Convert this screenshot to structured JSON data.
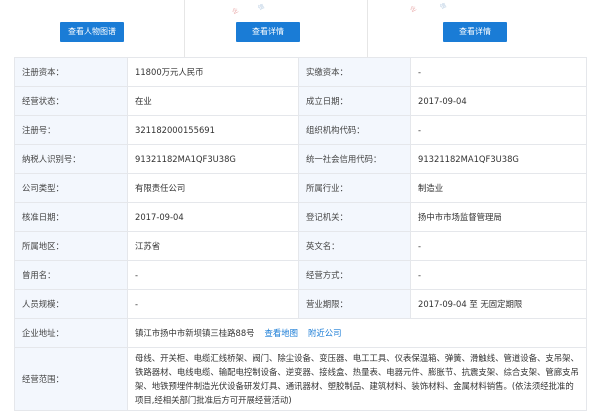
{
  "buttons": {
    "view_person_graph": "查看人物图谱",
    "view_detail_1": "查看详情",
    "view_detail_2": "查看详情"
  },
  "fields": {
    "reg_capital_label": "注册资本：",
    "reg_capital_value": "11800万元人民币",
    "paid_capital_label": "实缴资本：",
    "paid_capital_value": "-",
    "status_label": "经营状态：",
    "status_value": "在业",
    "est_date_label": "成立日期：",
    "est_date_value": "2017-09-04",
    "reg_no_label": "注册号：",
    "reg_no_value": "321182000155691",
    "org_code_label": "组织机构代码：",
    "org_code_value": "-",
    "taxpayer_id_label": "纳税人识别号：",
    "taxpayer_id_value": "91321182MA1QF3U38G",
    "credit_code_label": "统一社会信用代码：",
    "credit_code_value": "91321182MA1QF3U38G",
    "company_type_label": "公司类型：",
    "company_type_value": "有限责任公司",
    "industry_label": "所属行业：",
    "industry_value": "制造业",
    "approve_date_label": "核准日期：",
    "approve_date_value": "2017-09-04",
    "reg_authority_label": "登记机关：",
    "reg_authority_value": "扬中市市场监督管理局",
    "region_label": "所属地区：",
    "region_value": "江苏省",
    "english_name_label": "英文名：",
    "english_name_value": "-",
    "former_name_label": "曾用名：",
    "former_name_value": "-",
    "biz_mode_label": "经营方式：",
    "biz_mode_value": "-",
    "staff_size_label": "人员规模：",
    "staff_size_value": "-",
    "biz_term_label": "营业期限：",
    "biz_term_value": "2017-09-04 至 无固定期限",
    "address_label": "企业地址：",
    "address_value": "镇江市扬中市新坝镇三桂路88号",
    "address_map_link": "查看地图",
    "address_nearby_link": "附近公司",
    "scope_label": "经营范围：",
    "scope_value": "母线、开关柜、电缆汇线桥架、阀门、除尘设备、变压器、电工工具、仪表保温箱、弹簧、滑触线、管道设备、支吊架、铁路器材、电线电缆、输配电控制设备、逆变器、接线盒、热量表、电器元件、膨胀节、抗震支架、综合支架、管廊支吊架、地铁预埋件制造光伏设备研发灯具、通讯器材、塑胶制品、建筑材料、装饰材料、金属材料销售。(依法须经批准的项目,经相关部门批准后方可开展经营活动)"
  },
  "colors": {
    "button_blue": "#1a7cd6",
    "label_bg": "#f3f7fd",
    "border": "#e5e7eb",
    "link": "#1a7cd6"
  }
}
